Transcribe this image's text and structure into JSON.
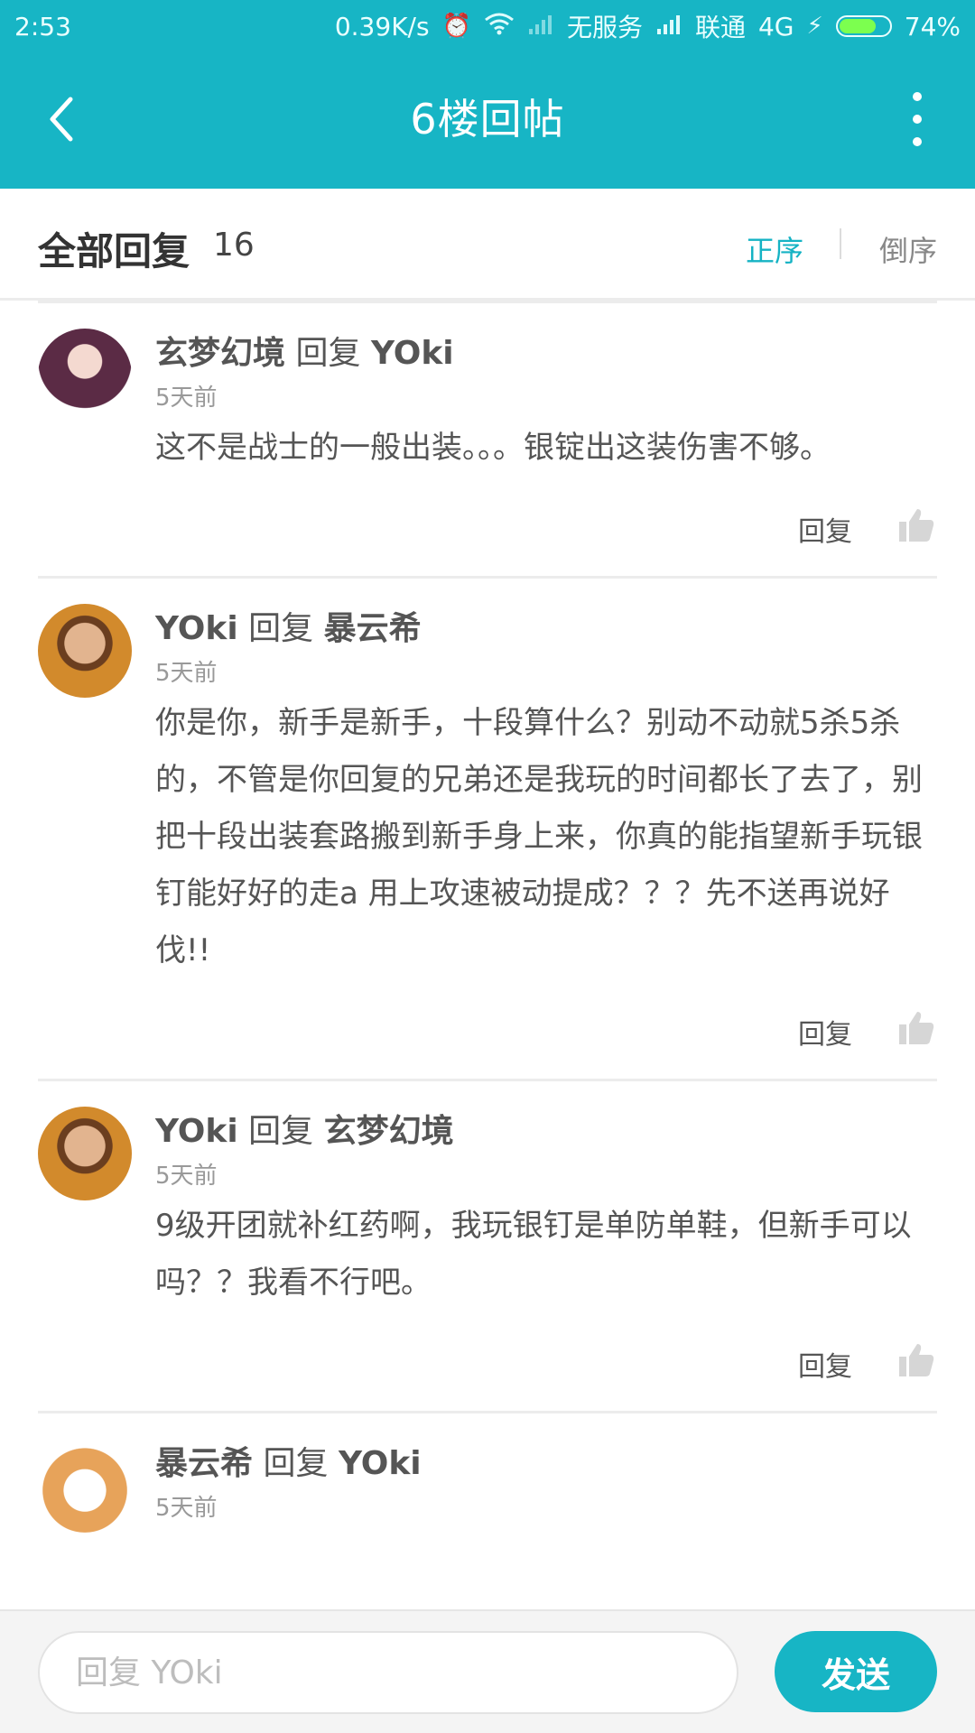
{
  "status_bar": {
    "time": "2:53",
    "speed": "0.39K/s",
    "sim1": "无服务",
    "carrier": "联通",
    "network": "4G",
    "battery": "74%",
    "battery_level": 0.74
  },
  "header": {
    "title": "6楼回帖"
  },
  "sortbar": {
    "title": "全部回复",
    "count": "16",
    "asc_label": "正序",
    "desc_label": "倒序"
  },
  "feed": {
    "reply_label": "回复",
    "comments": [
      {
        "user": "玄梦幻境",
        "reply_word": "回复",
        "target": "YOki",
        "time": "5天前",
        "body": "这不是战士的一般出装。。。银锭出这装伤害不够。"
      },
      {
        "user": "YOki",
        "reply_word": "回复",
        "target": "暴云希",
        "time": "5天前",
        "body": "你是你，新手是新手，十段算什么？别动不动就5杀5杀的，不管是你回复的兄弟还是我玩的时间都长了去了，别把十段出装套路搬到新手身上来，你真的能指望新手玩银钉能好好的走a 用上攻速被动提成？？？先不送再说好伐!!"
      },
      {
        "user": "YOki",
        "reply_word": "回复",
        "target": "玄梦幻境",
        "time": "5天前",
        "body": "9级开团就补红药啊，我玩银钉是单防单鞋，但新手可以吗？？我看不行吧。"
      },
      {
        "user": "暴云希",
        "reply_word": "回复",
        "target": "YOki",
        "time": "5天前",
        "body": ""
      }
    ]
  },
  "bottom": {
    "input_placeholder": "回复 YOki",
    "send_label": "发送"
  }
}
